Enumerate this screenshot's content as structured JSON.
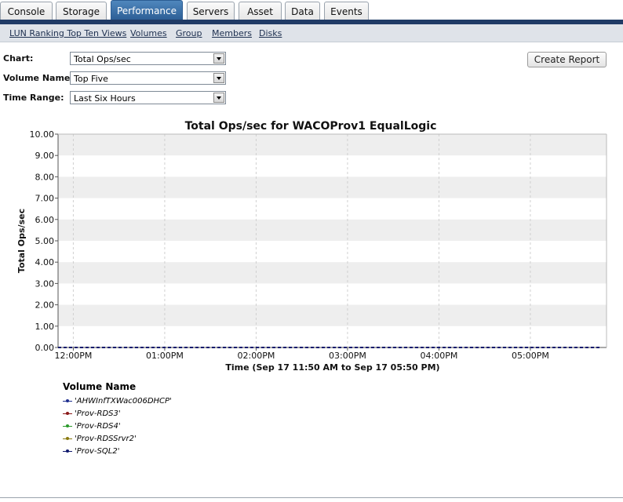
{
  "tabs": [
    {
      "label": "Console",
      "active": false
    },
    {
      "label": "Storage",
      "active": false
    },
    {
      "label": "Performance",
      "active": true
    },
    {
      "label": "Servers",
      "active": false
    },
    {
      "label": "Asset",
      "active": false
    },
    {
      "label": "Data",
      "active": false
    },
    {
      "label": "Events",
      "active": false
    }
  ],
  "subnav": [
    "LUN Ranking Top Ten Views",
    "Volumes",
    "Group",
    "Members",
    "Disks"
  ],
  "form": {
    "chart_label": "Chart:",
    "chart_value": "Total Ops/sec",
    "volume_label": "Volume Name:",
    "volume_value": "Top Five",
    "range_label": "Time Range:",
    "range_value": "Last Six Hours"
  },
  "create_report_label": "Create Report",
  "colors": {
    "accent": "#2c5d94",
    "band": "#203b66"
  },
  "chart_data": {
    "type": "line",
    "title": "Total Ops/sec for WACOProv1 EqualLogic",
    "xlabel": "Time (Sep 17 11:50 AM to Sep 17 05:50 PM)",
    "ylabel": "Total Ops/sec",
    "ylim": [
      0,
      10
    ],
    "yticks": [
      "0.00",
      "1.00",
      "2.00",
      "3.00",
      "4.00",
      "5.00",
      "6.00",
      "7.00",
      "8.00",
      "9.00",
      "10.00"
    ],
    "xticks": [
      "12:00PM",
      "01:00PM",
      "02:00PM",
      "03:00PM",
      "04:00PM",
      "05:00PM"
    ],
    "grid": true,
    "legend_title": "Volume Name",
    "legend_position": "bottom-left",
    "series": [
      {
        "name": "'AHWInfTXWac006DHCP'",
        "color": "#1f2f8f",
        "values": [
          0,
          0,
          0,
          0,
          0,
          0,
          0
        ]
      },
      {
        "name": "'Prov-RDS3'",
        "color": "#8b1a1a",
        "values": [
          0,
          0,
          0,
          0,
          0,
          0,
          0
        ]
      },
      {
        "name": "'Prov-RDS4'",
        "color": "#2a9a2a",
        "values": [
          0,
          0,
          0,
          0,
          0,
          0,
          0
        ]
      },
      {
        "name": "'Prov-RDSSrvr2'",
        "color": "#8a7a10",
        "values": [
          0,
          0,
          0,
          0,
          0,
          0,
          0
        ]
      },
      {
        "name": "'Prov-SQL2'",
        "color": "#101a6e",
        "values": [
          0,
          0,
          0,
          0,
          0,
          0,
          0
        ]
      }
    ]
  }
}
